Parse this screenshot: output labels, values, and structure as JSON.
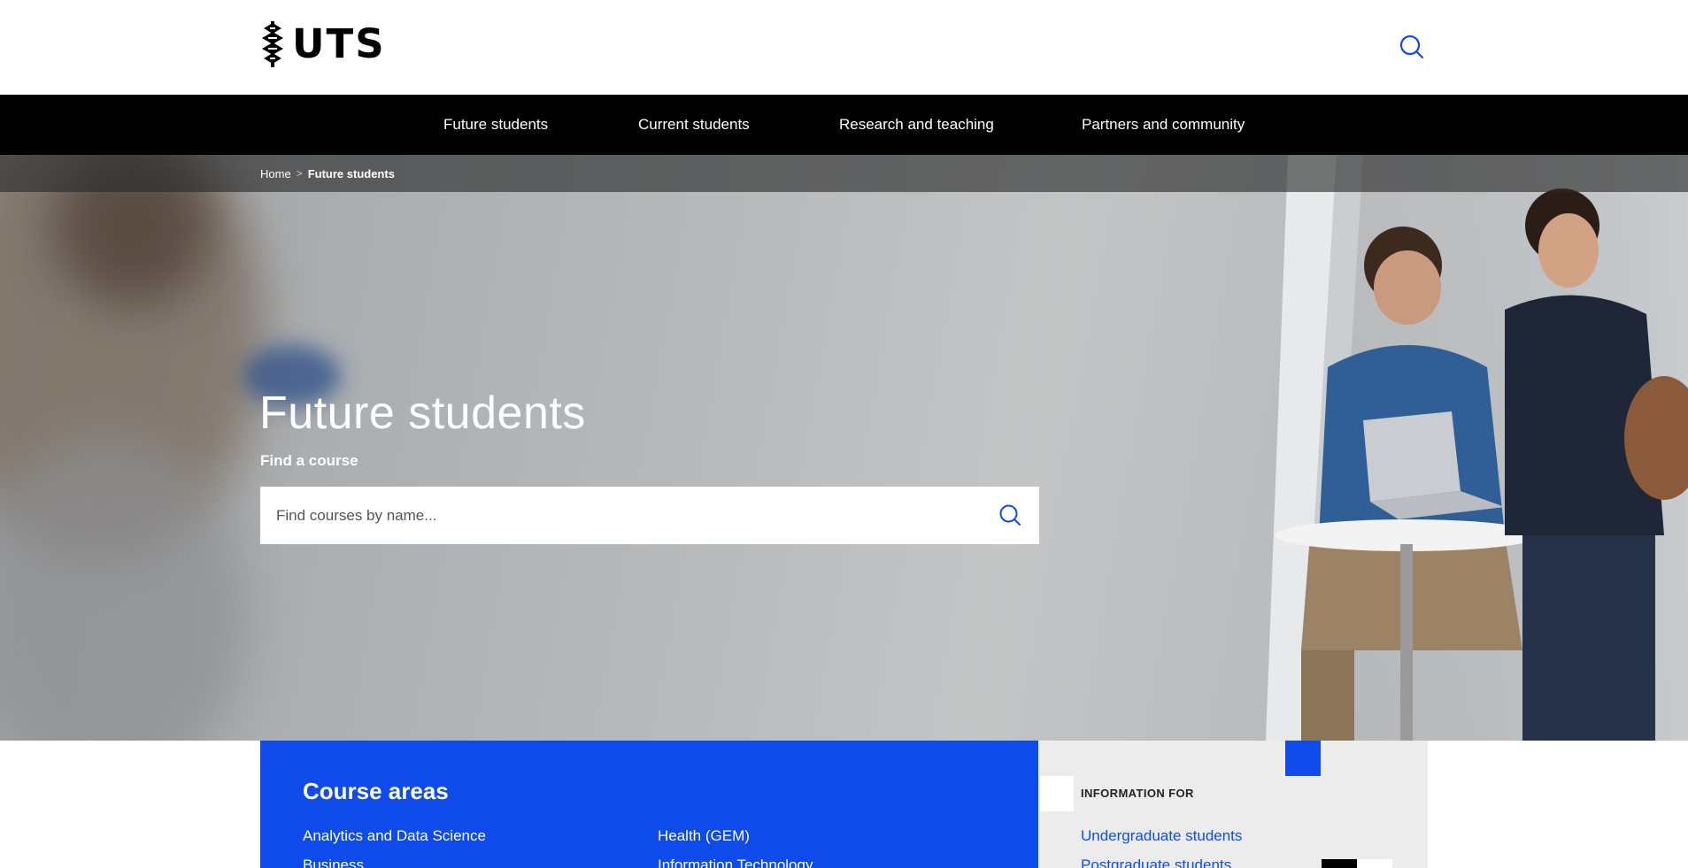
{
  "header": {
    "logo_text": "UTS",
    "logo_icon": "uts-crest-icon",
    "search_icon": "search-icon"
  },
  "nav": {
    "items": [
      {
        "label": "Future students"
      },
      {
        "label": "Current students"
      },
      {
        "label": "Research and teaching"
      },
      {
        "label": "Partners and community"
      }
    ]
  },
  "breadcrumb": {
    "home": "Home",
    "separator": ">",
    "current": "Future students"
  },
  "hero": {
    "title": "Future students",
    "find_label": "Find a course",
    "search_placeholder": "Find courses by name...",
    "search_value": "",
    "search_icon": "search-icon"
  },
  "course_areas": {
    "title": "Course areas",
    "items": [
      {
        "label": "Analytics and Data Science"
      },
      {
        "label": "Business"
      },
      {
        "label": "Health (GEM)"
      },
      {
        "label": "Information Technology"
      }
    ]
  },
  "information_for": {
    "heading": "INFORMATION FOR",
    "items": [
      {
        "label": "Undergraduate students"
      },
      {
        "label": "Postgraduate students"
      }
    ]
  },
  "colors": {
    "brand_blue": "#0f4beb",
    "nav_bg": "#000000",
    "info_bg": "#ececec"
  }
}
